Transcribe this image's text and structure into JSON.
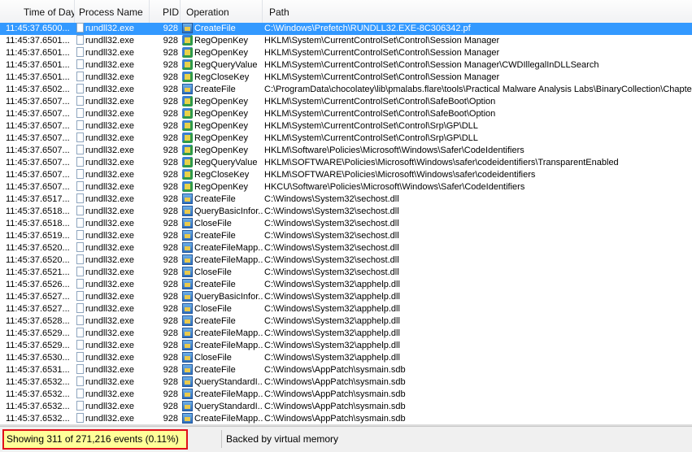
{
  "columns": {
    "time": "Time of Day",
    "process": "Process Name",
    "pid": "PID",
    "operation": "Operation",
    "path": "Path"
  },
  "rows": [
    {
      "time": "11:45:37.6500...",
      "process": "rundll32.exe",
      "pid": "928",
      "icon": "file",
      "op": "CreateFile",
      "path": "C:\\Windows\\Prefetch\\RUNDLL32.EXE-8C306342.pf"
    },
    {
      "time": "11:45:37.6501...",
      "process": "rundll32.exe",
      "pid": "928",
      "icon": "reg",
      "op": "RegOpenKey",
      "path": "HKLM\\System\\CurrentControlSet\\Control\\Session Manager"
    },
    {
      "time": "11:45:37.6501...",
      "process": "rundll32.exe",
      "pid": "928",
      "icon": "reg",
      "op": "RegOpenKey",
      "path": "HKLM\\System\\CurrentControlSet\\Control\\Session Manager"
    },
    {
      "time": "11:45:37.6501...",
      "process": "rundll32.exe",
      "pid": "928",
      "icon": "reg",
      "op": "RegQueryValue",
      "path": "HKLM\\System\\CurrentControlSet\\Control\\Session Manager\\CWDIllegalInDLLSearch"
    },
    {
      "time": "11:45:37.6501...",
      "process": "rundll32.exe",
      "pid": "928",
      "icon": "reg",
      "op": "RegCloseKey",
      "path": "HKLM\\System\\CurrentControlSet\\Control\\Session Manager"
    },
    {
      "time": "11:45:37.6502...",
      "process": "rundll32.exe",
      "pid": "928",
      "icon": "file",
      "op": "CreateFile",
      "path": "C:\\ProgramData\\chocolatey\\lib\\pmalabs.flare\\tools\\Practical Malware Analysis Labs\\BinaryCollection\\Chapter_"
    },
    {
      "time": "11:45:37.6507...",
      "process": "rundll32.exe",
      "pid": "928",
      "icon": "reg",
      "op": "RegOpenKey",
      "path": "HKLM\\System\\CurrentControlSet\\Control\\SafeBoot\\Option"
    },
    {
      "time": "11:45:37.6507...",
      "process": "rundll32.exe",
      "pid": "928",
      "icon": "reg",
      "op": "RegOpenKey",
      "path": "HKLM\\System\\CurrentControlSet\\Control\\SafeBoot\\Option"
    },
    {
      "time": "11:45:37.6507...",
      "process": "rundll32.exe",
      "pid": "928",
      "icon": "reg",
      "op": "RegOpenKey",
      "path": "HKLM\\System\\CurrentControlSet\\Control\\Srp\\GP\\DLL"
    },
    {
      "time": "11:45:37.6507...",
      "process": "rundll32.exe",
      "pid": "928",
      "icon": "reg",
      "op": "RegOpenKey",
      "path": "HKLM\\System\\CurrentControlSet\\Control\\Srp\\GP\\DLL"
    },
    {
      "time": "11:45:37.6507...",
      "process": "rundll32.exe",
      "pid": "928",
      "icon": "reg",
      "op": "RegOpenKey",
      "path": "HKLM\\Software\\Policies\\Microsoft\\Windows\\Safer\\CodeIdentifiers"
    },
    {
      "time": "11:45:37.6507...",
      "process": "rundll32.exe",
      "pid": "928",
      "icon": "reg",
      "op": "RegQueryValue",
      "path": "HKLM\\SOFTWARE\\Policies\\Microsoft\\Windows\\safer\\codeidentifiers\\TransparentEnabled"
    },
    {
      "time": "11:45:37.6507...",
      "process": "rundll32.exe",
      "pid": "928",
      "icon": "reg",
      "op": "RegCloseKey",
      "path": "HKLM\\SOFTWARE\\Policies\\Microsoft\\Windows\\safer\\codeidentifiers"
    },
    {
      "time": "11:45:37.6507...",
      "process": "rundll32.exe",
      "pid": "928",
      "icon": "reg",
      "op": "RegOpenKey",
      "path": "HKCU\\Software\\Policies\\Microsoft\\Windows\\Safer\\CodeIdentifiers"
    },
    {
      "time": "11:45:37.6517...",
      "process": "rundll32.exe",
      "pid": "928",
      "icon": "file",
      "op": "CreateFile",
      "path": "C:\\Windows\\System32\\sechost.dll"
    },
    {
      "time": "11:45:37.6518...",
      "process": "rundll32.exe",
      "pid": "928",
      "icon": "file",
      "op": "QueryBasicInfor...",
      "path": "C:\\Windows\\System32\\sechost.dll"
    },
    {
      "time": "11:45:37.6518...",
      "process": "rundll32.exe",
      "pid": "928",
      "icon": "file",
      "op": "CloseFile",
      "path": "C:\\Windows\\System32\\sechost.dll"
    },
    {
      "time": "11:45:37.6519...",
      "process": "rundll32.exe",
      "pid": "928",
      "icon": "file",
      "op": "CreateFile",
      "path": "C:\\Windows\\System32\\sechost.dll"
    },
    {
      "time": "11:45:37.6520...",
      "process": "rundll32.exe",
      "pid": "928",
      "icon": "file",
      "op": "CreateFileMapp...",
      "path": "C:\\Windows\\System32\\sechost.dll"
    },
    {
      "time": "11:45:37.6520...",
      "process": "rundll32.exe",
      "pid": "928",
      "icon": "file",
      "op": "CreateFileMapp...",
      "path": "C:\\Windows\\System32\\sechost.dll"
    },
    {
      "time": "11:45:37.6521...",
      "process": "rundll32.exe",
      "pid": "928",
      "icon": "file",
      "op": "CloseFile",
      "path": "C:\\Windows\\System32\\sechost.dll"
    },
    {
      "time": "11:45:37.6526...",
      "process": "rundll32.exe",
      "pid": "928",
      "icon": "file",
      "op": "CreateFile",
      "path": "C:\\Windows\\System32\\apphelp.dll"
    },
    {
      "time": "11:45:37.6527...",
      "process": "rundll32.exe",
      "pid": "928",
      "icon": "file",
      "op": "QueryBasicInfor...",
      "path": "C:\\Windows\\System32\\apphelp.dll"
    },
    {
      "time": "11:45:37.6527...",
      "process": "rundll32.exe",
      "pid": "928",
      "icon": "file",
      "op": "CloseFile",
      "path": "C:\\Windows\\System32\\apphelp.dll"
    },
    {
      "time": "11:45:37.6528...",
      "process": "rundll32.exe",
      "pid": "928",
      "icon": "file",
      "op": "CreateFile",
      "path": "C:\\Windows\\System32\\apphelp.dll"
    },
    {
      "time": "11:45:37.6529...",
      "process": "rundll32.exe",
      "pid": "928",
      "icon": "file",
      "op": "CreateFileMapp...",
      "path": "C:\\Windows\\System32\\apphelp.dll"
    },
    {
      "time": "11:45:37.6529...",
      "process": "rundll32.exe",
      "pid": "928",
      "icon": "file",
      "op": "CreateFileMapp...",
      "path": "C:\\Windows\\System32\\apphelp.dll"
    },
    {
      "time": "11:45:37.6530...",
      "process": "rundll32.exe",
      "pid": "928",
      "icon": "file",
      "op": "CloseFile",
      "path": "C:\\Windows\\System32\\apphelp.dll"
    },
    {
      "time": "11:45:37.6531...",
      "process": "rundll32.exe",
      "pid": "928",
      "icon": "file",
      "op": "CreateFile",
      "path": "C:\\Windows\\AppPatch\\sysmain.sdb"
    },
    {
      "time": "11:45:37.6532...",
      "process": "rundll32.exe",
      "pid": "928",
      "icon": "file",
      "op": "QueryStandardI...",
      "path": "C:\\Windows\\AppPatch\\sysmain.sdb"
    },
    {
      "time": "11:45:37.6532...",
      "process": "rundll32.exe",
      "pid": "928",
      "icon": "file",
      "op": "CreateFileMapp...",
      "path": "C:\\Windows\\AppPatch\\sysmain.sdb"
    },
    {
      "time": "11:45:37.6532...",
      "process": "rundll32.exe",
      "pid": "928",
      "icon": "file",
      "op": "QueryStandardI...",
      "path": "C:\\Windows\\AppPatch\\sysmain.sdb"
    },
    {
      "time": "11:45:37.6532...",
      "process": "rundll32.exe",
      "pid": "928",
      "icon": "file",
      "op": "CreateFileMapp...",
      "path": "C:\\Windows\\AppPatch\\sysmain.sdb"
    }
  ],
  "selected_row": 0,
  "status": {
    "events": "Showing 311 of 271,216 events (0.11%)",
    "memory": "Backed by virtual memory"
  },
  "colors": {
    "selection": "#3399ff",
    "highlight_bg": "#ffff99",
    "highlight_border": "#e0101a"
  }
}
